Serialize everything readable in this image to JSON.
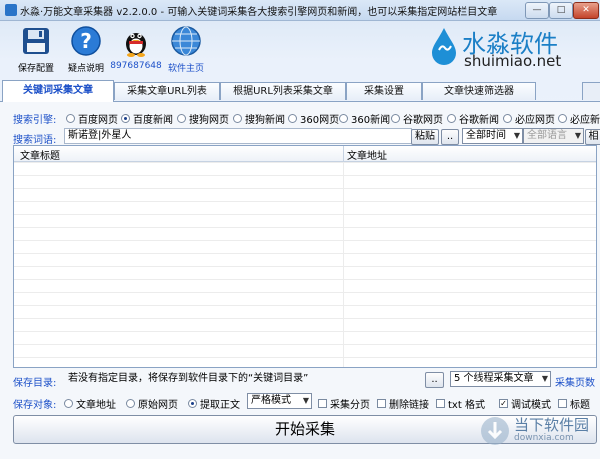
{
  "window": {
    "title": "水淼·万能文章采集器 v2.2.0.0 - 可输入关键词采集各大搜索引擎网页和新闻，也可以采集指定网站栏目文章",
    "controls": {
      "minimize": "—",
      "maximize": "□",
      "close": "✕"
    }
  },
  "toolbar": {
    "save_config": "保存配置",
    "help": "疑点说明",
    "qq": "897687648",
    "homepage": "软件主页"
  },
  "brand": {
    "name": "水淼软件",
    "url": "shuimiao.net"
  },
  "tabs": [
    "关键词采集文章",
    "采集文章URL列表",
    "根据URL列表采集文章",
    "采集设置",
    "文章快速筛选器"
  ],
  "search_engine": {
    "label": "搜索引擎:",
    "options": [
      "百度网页",
      "百度新闻",
      "搜狗网页",
      "搜狗新闻",
      "360网页",
      "360新闻",
      "谷歌网页",
      "谷歌新闻",
      "必应网页",
      "必应新"
    ],
    "selected": "百度新闻"
  },
  "keywords": {
    "label": "搜索词语:",
    "value": "斯诺登|外星人",
    "paste": "粘贴",
    "browse": "..",
    "time": "全部时间",
    "language": "全部语言",
    "extra": "相"
  },
  "table": {
    "columns": [
      "文章标题",
      "文章地址"
    ],
    "rows": []
  },
  "save_dir": {
    "label": "保存目录:",
    "value": "若没有指定目录，将保存到软件目录下的“关键词目录”",
    "browse": "..",
    "threads": "5 个线程采集文章",
    "pages_label": "采集页数"
  },
  "save_target": {
    "label": "保存对象:",
    "options": [
      "文章地址",
      "原始网页",
      "提取正文"
    ],
    "selected": "提取正文",
    "mode": "严格模式",
    "checks": [
      {
        "label": "采集分页",
        "checked": false
      },
      {
        "label": "删除链接",
        "checked": false
      },
      {
        "label": "txt 格式",
        "checked": false
      },
      {
        "label": "调试模式",
        "checked": true
      },
      {
        "label": "标题",
        "checked": false
      }
    ]
  },
  "start_button": "开始采集",
  "watermark": {
    "name": "当下软件园",
    "url": "downxia.com"
  }
}
